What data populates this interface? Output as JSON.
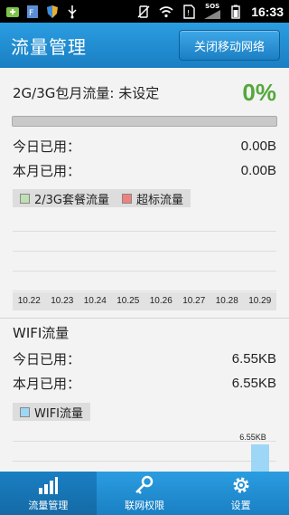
{
  "statusbar": {
    "time": "16:33",
    "sos": "SOS"
  },
  "header": {
    "title": "流量管理",
    "close_network_button": "关闭移动网络"
  },
  "plan": {
    "label": "2G/3G包月流量: 未设定",
    "percent_text": "0%",
    "usage_fraction": 0
  },
  "mobile": {
    "today_label": "今日已用：",
    "today_value": "0.00B",
    "month_label": "本月已用：",
    "month_value": "0.00B",
    "legend": [
      {
        "label": "2/3G套餐流量",
        "color": "#bfe0b1"
      },
      {
        "label": "超标流量",
        "color": "#f08080"
      }
    ],
    "dates": [
      "10.22",
      "10.23",
      "10.24",
      "10.25",
      "10.26",
      "10.27",
      "10.28",
      "10.29"
    ]
  },
  "wifi": {
    "title": "WIFI流量",
    "today_label": "今日已用：",
    "today_value": "6.55KB",
    "month_label": "本月已用：",
    "month_value": "6.55KB",
    "legend_label": "WIFI流量",
    "legend_color": "#9ed7f5",
    "bar_label": "6.55KB"
  },
  "nav": {
    "tabs": [
      {
        "label": "流量管理",
        "icon": "bar-chart-icon"
      },
      {
        "label": "联网权限",
        "icon": "key-icon"
      },
      {
        "label": "设置",
        "icon": "gear-icon"
      }
    ]
  }
}
